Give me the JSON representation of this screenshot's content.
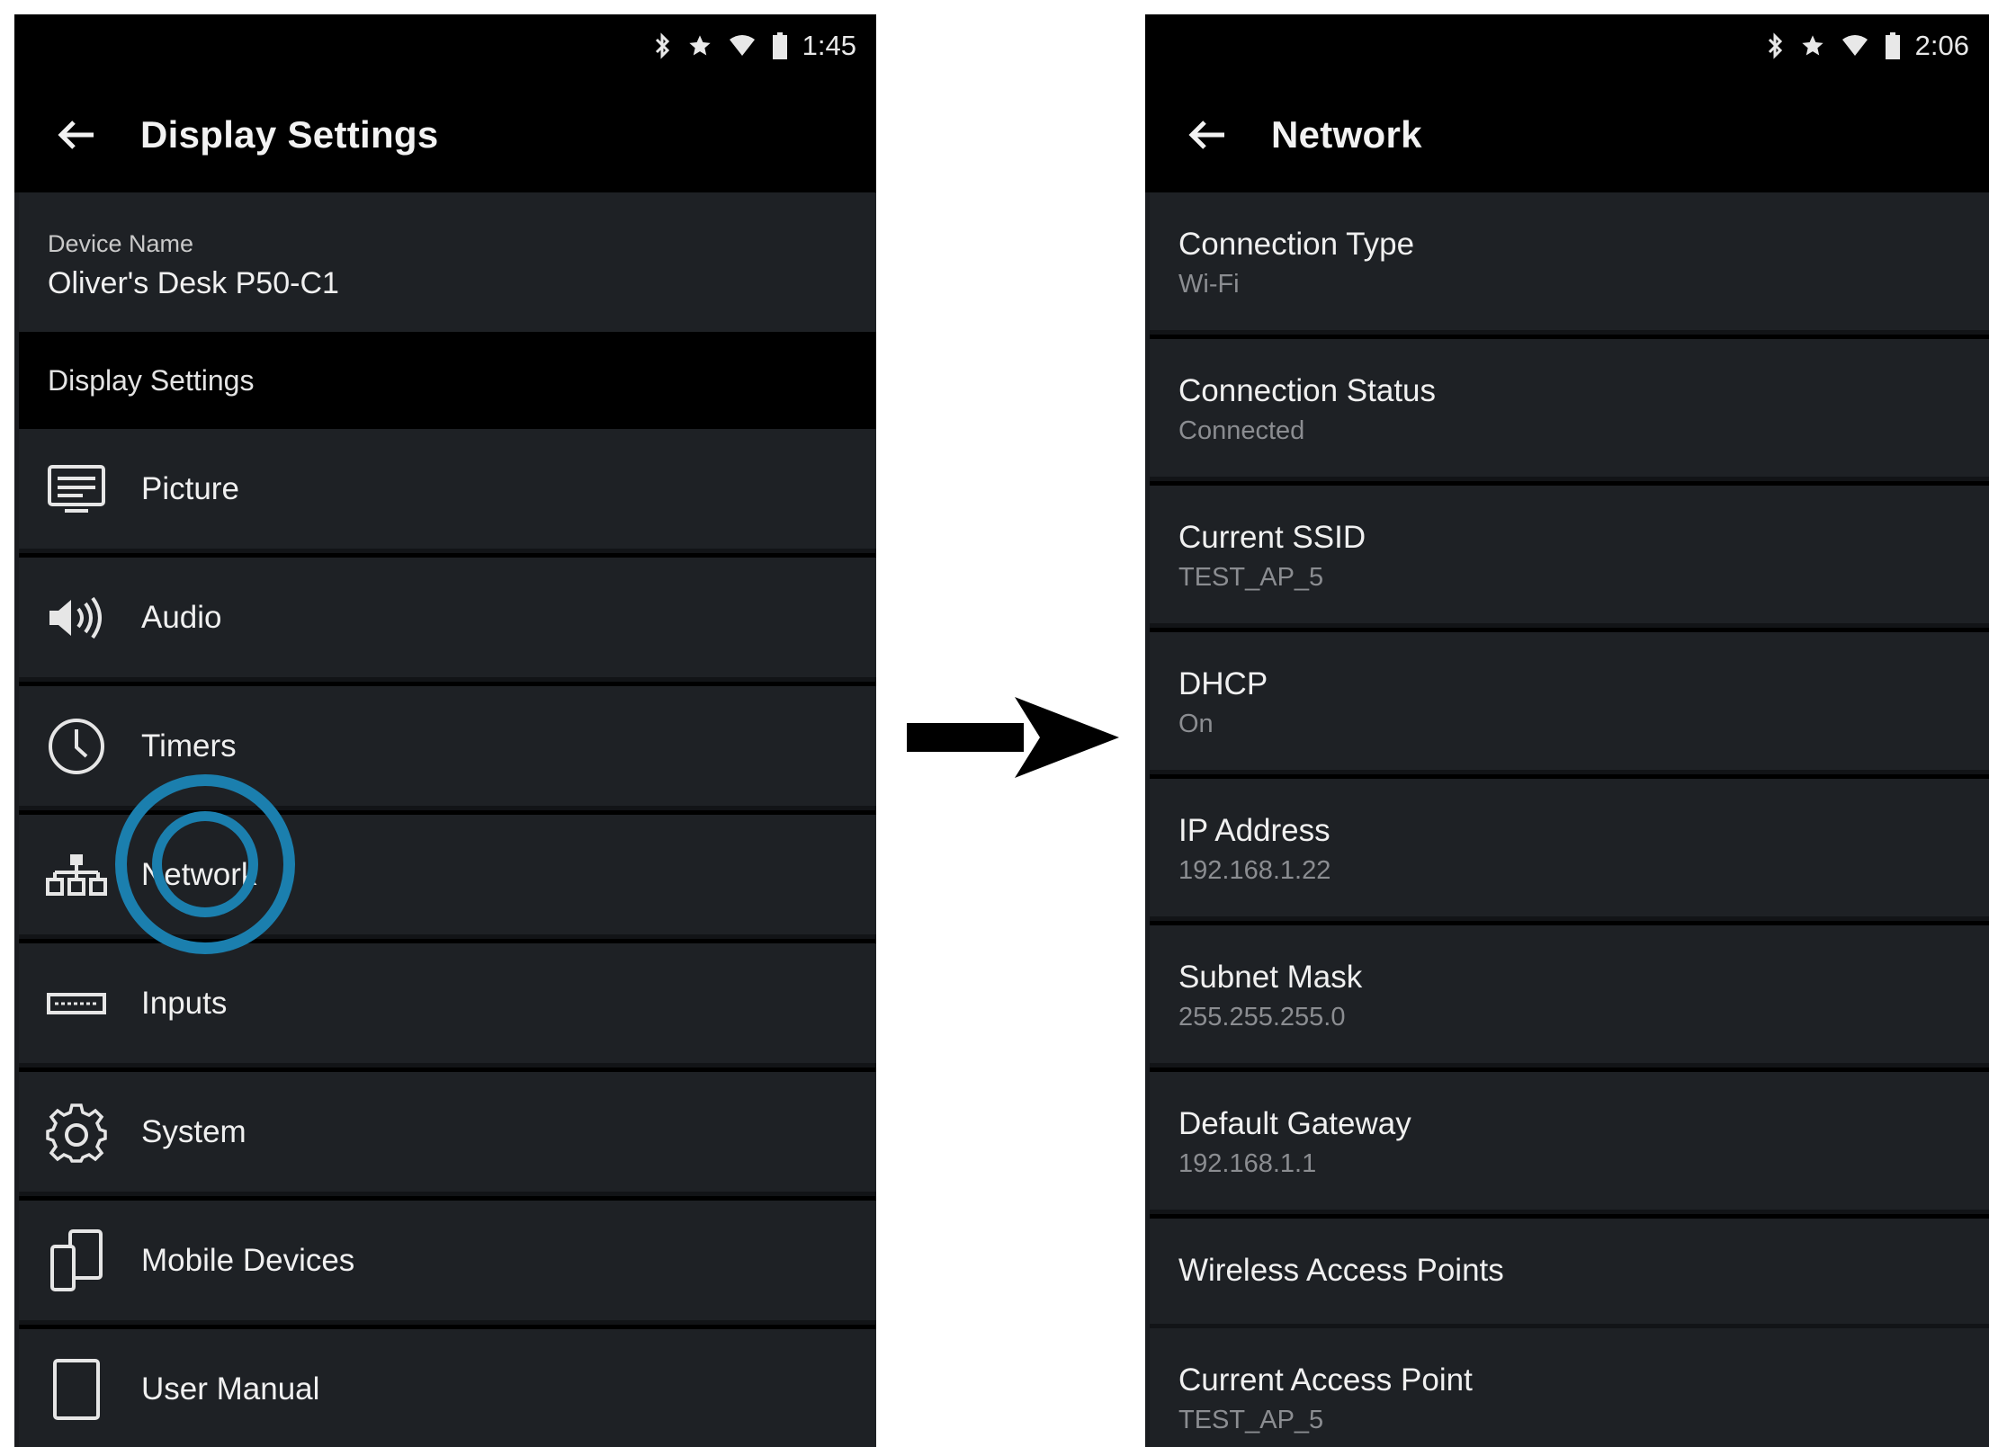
{
  "left_screen": {
    "status_time": "1:45",
    "title": "Display Settings",
    "device": {
      "label": "Device Name",
      "value": "Oliver's Desk P50-C1"
    },
    "section_header": "Display Settings",
    "menu": [
      {
        "label": "Picture",
        "icon": "picture-icon"
      },
      {
        "label": "Audio",
        "icon": "speaker-icon"
      },
      {
        "label": "Timers",
        "icon": "clock-icon"
      },
      {
        "label": "Network",
        "icon": "network-icon"
      },
      {
        "label": "Inputs",
        "icon": "input-icon"
      },
      {
        "label": "System",
        "icon": "gear-icon"
      },
      {
        "label": "Mobile Devices",
        "icon": "mobile-devices-icon"
      },
      {
        "label": "User Manual",
        "icon": "tablet-icon"
      }
    ]
  },
  "right_screen": {
    "status_time": "2:06",
    "title": "Network",
    "items": [
      {
        "label": "Connection Type",
        "value": "Wi-Fi"
      },
      {
        "label": "Connection Status",
        "value": "Connected"
      },
      {
        "label": "Current SSID",
        "value": "TEST_AP_5"
      },
      {
        "label": "DHCP",
        "value": "On"
      },
      {
        "label": "IP Address",
        "value": "192.168.1.22"
      },
      {
        "label": "Subnet Mask",
        "value": "255.255.255.0"
      },
      {
        "label": "Default Gateway",
        "value": "192.168.1.1"
      },
      {
        "label": "Wireless Access Points",
        "value": ""
      },
      {
        "label": "Current Access Point",
        "value": "TEST_AP_5"
      }
    ]
  },
  "colors": {
    "background": "#1e2125",
    "header": "#000000",
    "text": "#f0f0f0",
    "subtext": "#8b8d91",
    "touch_indicator": "#1b7fae"
  }
}
